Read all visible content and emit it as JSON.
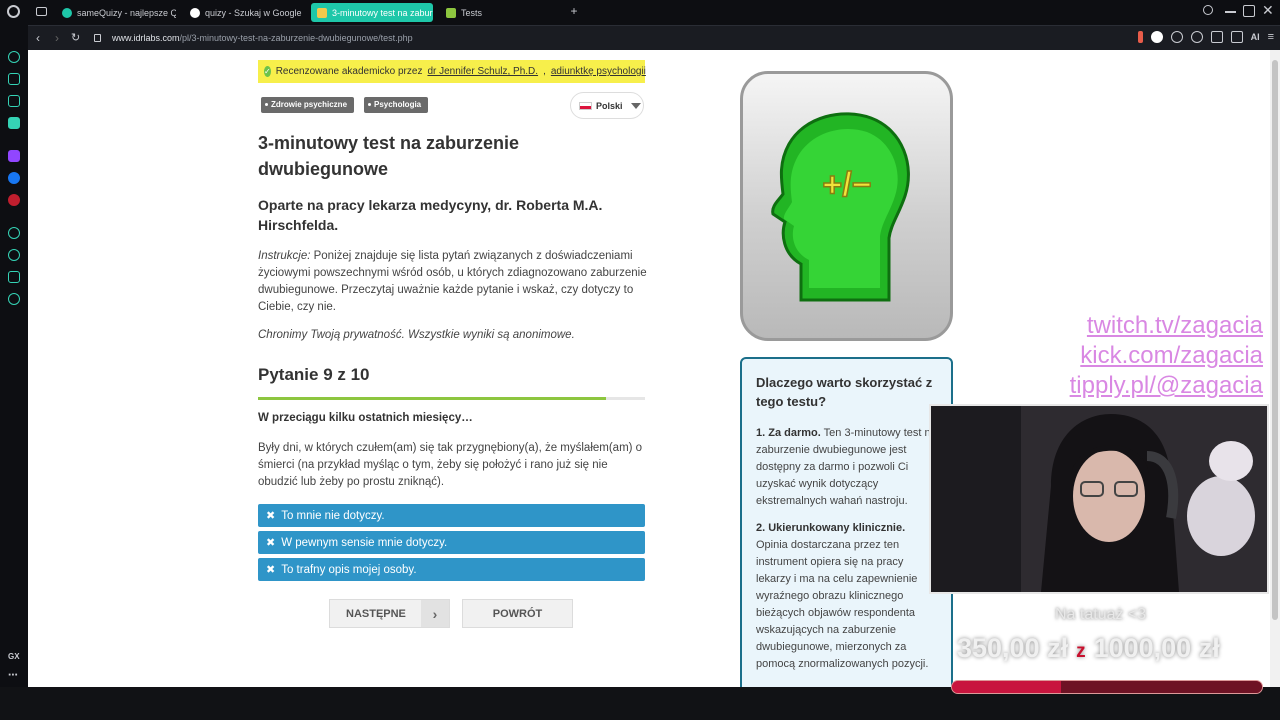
{
  "browser": {
    "tabs": [
      {
        "label": "sameQuizy - najlepsze Qu",
        "favicon_color": "#1ec7a9",
        "active": false
      },
      {
        "label": "quizy - Szukaj w Google",
        "favicon_color": "#ffffff",
        "active": false
      },
      {
        "label": "3-minutowy test na zabur",
        "favicon_color": "#f2c94c",
        "active": true
      },
      {
        "label": "Tests",
        "favicon_color": "#8dc63f",
        "active": false
      }
    ],
    "url_host": "www.idrlabs.com",
    "url_path": "/pl/3-minutowy-test-na-zaburzenie-dwubiegunowe/test.php",
    "ai_label": "AI",
    "sidebar_gx": "GX"
  },
  "page": {
    "review_prefix": "Recenzowane akademicko przez",
    "reviewer": "dr Jennifer Schulz, Ph.D.",
    "reviewer_role": "adiunktkę psychologii",
    "tags": [
      "Zdrowie psychiczne",
      "Psychologia"
    ],
    "language": "Polski",
    "title": "3-minutowy test na zaburzenie dwubiegunowe",
    "subtitle": "Oparte na pracy lekarza medycyny, dr. Roberta M.A. Hirschfelda.",
    "instruction_label": "Instrukcje:",
    "instruction_text": " Poniżej znajduje się lista pytań związanych z doświadczeniami życiowymi powszechnymi wśród osób, u których zdiagnozowano zaburzenie dwubiegunowe. Przeczytaj uważnie każde pytanie i wskaż, czy dotyczy to Ciebie, czy nie.",
    "privacy": "Chronimy Twoją prywatność. Wszystkie wyniki są anonimowe.",
    "question_number": "Pytanie 9 z 10",
    "progress": 0.9,
    "question_heading": "W przeciągu kilku ostatnich miesięcy…",
    "question_text": "Były dni, w których czułem(am) się tak przygnębiony(a), że myślałem(am) o śmierci (na przykład myśląc o tym, żeby się położyć i rano już się nie obudzić lub żeby po prostu zniknąć).",
    "answers": [
      "To mnie nie dotyczy.",
      "W pewnym sensie mnie dotyczy.",
      "To trafny opis mojej osoby."
    ],
    "next_label": "NASTĘPNE",
    "back_label": "POWRÓT",
    "logo_symbol": "+/−",
    "why_title": "Dlaczego warto skorzystać z tego testu?",
    "why_1_title": "1. Za darmo.",
    "why_1_text": " Ten 3-minutowy test na zaburzenie dwubiegunowe jest dostępny za darmo i pozwoli Ci uzyskać wynik dotyczący ekstremalnych wahań nastroju.",
    "why_2_title": "2. Ukierunkowany klinicznie.",
    "why_2_text": " Opinia dostarczana przez ten instrument opiera się na pracy lekarzy i ma na celu zapewnienie wyraźnego obrazu klinicznego bieżących objawów respondenta wskazujących na zaburzenie dwubiegunowe, mierzonych za pomocą znormalizowanych pozycji."
  },
  "stream": {
    "links": [
      "twitch.tv/zagacia",
      "kick.com/zagacia",
      "tipply.pl/@zagacia"
    ],
    "goal_title": "Na tatuaż <3",
    "goal_current": "350,00 zł",
    "goal_separator": "z",
    "goal_target": "1000,00 zł",
    "goal_progress": 0.35
  }
}
